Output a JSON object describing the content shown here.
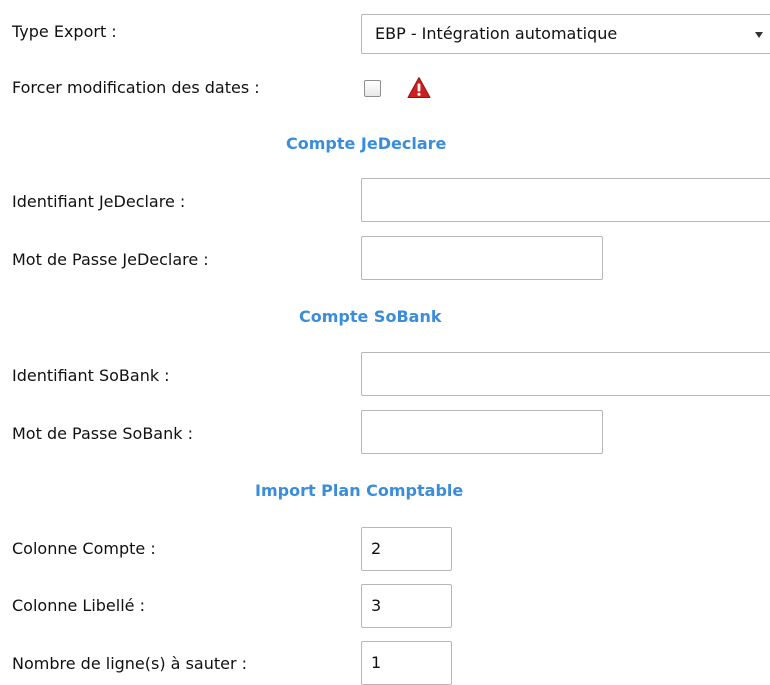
{
  "type_export": {
    "label": "Type Export :",
    "selected": "EBP - Intégration automatique"
  },
  "forcer_dates": {
    "label": "Forcer modification des dates :",
    "checked": false
  },
  "jedeclare": {
    "section_title": "Compte JeDeclare",
    "identifiant_label": "Identifiant JeDeclare :",
    "identifiant_value": "",
    "password_label": "Mot de Passe JeDeclare :",
    "password_value": ""
  },
  "sobank": {
    "section_title": "Compte SoBank",
    "identifiant_label": "Identifiant SoBank :",
    "identifiant_value": "",
    "password_label": "Mot de Passe SoBank :",
    "password_value": ""
  },
  "import_plan": {
    "section_title": "Import Plan Comptable",
    "colonne_compte_label": "Colonne Compte :",
    "colonne_compte_value": "2",
    "colonne_libelle_label": "Colonne Libellé :",
    "colonne_libelle_value": "3",
    "lignes_sauter_label": "Nombre de ligne(s) à sauter :",
    "lignes_sauter_value": "1"
  },
  "colors": {
    "section_title": "#3a8ddb",
    "warning_icon": "#cc1f1f",
    "field_border": "#b7b7b7"
  },
  "icons": {
    "warning": "warning-triangle-icon",
    "dropdown": "chevron-down-icon"
  }
}
